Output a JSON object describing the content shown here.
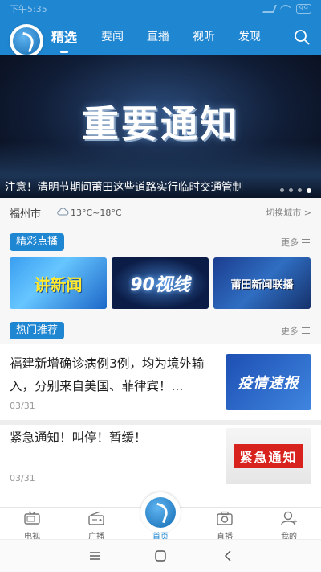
{
  "status_bar": {
    "time": "下午5:35",
    "battery": "99"
  },
  "header": {
    "tabs": [
      {
        "label": "精选",
        "active": true
      },
      {
        "label": "要闻",
        "active": false
      },
      {
        "label": "直播",
        "active": false
      },
      {
        "label": "视听",
        "active": false
      },
      {
        "label": "发现",
        "active": false
      }
    ],
    "search_icon": "search-icon",
    "accent_color": "#1f86d2"
  },
  "banner": {
    "title": "重要通知",
    "caption": "注意！清明节期间莆田这些道路实行临时交通管制",
    "slide_count": 4,
    "active_slide": 4
  },
  "weather": {
    "city": "福州市",
    "temperature": "13°C~18°C",
    "icon": "cloud-icon",
    "switch_label": "切换城市 >"
  },
  "featured": {
    "label": "精彩点播",
    "more": "更多",
    "thumbnails": [
      {
        "text": "讲新闻"
      },
      {
        "text": "90视线"
      },
      {
        "text": "莆田新闻联播"
      }
    ]
  },
  "hot": {
    "label": "热门推荐",
    "more": "更多",
    "items": [
      {
        "title": "福建新增确诊病例3例，均为境外输入，分别来自美国、菲律宾！...",
        "date": "03/31",
        "image_text": "疫情速报"
      },
      {
        "title": "紧急通知！叫停！暂缓！",
        "date": "03/31",
        "image_text": "紧急通知"
      }
    ]
  },
  "bottom_nav": {
    "items": [
      {
        "label": "电视",
        "icon": "tv-icon"
      },
      {
        "label": "广播",
        "icon": "radio-icon"
      },
      {
        "label": "首页",
        "icon": "home-logo-icon",
        "active": true
      },
      {
        "label": "直播",
        "icon": "camera-icon"
      },
      {
        "label": "我的",
        "icon": "user-icon"
      }
    ]
  }
}
